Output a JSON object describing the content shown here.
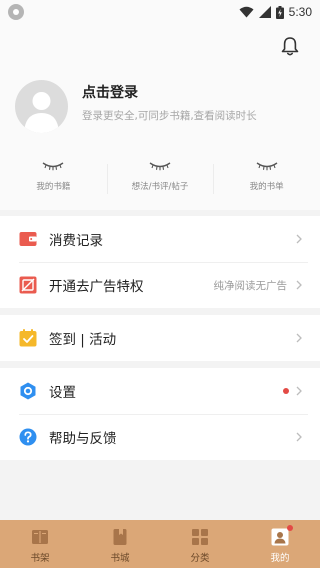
{
  "status_bar": {
    "time": "5:30"
  },
  "header": {
    "login_title": "点击登录",
    "login_subtitle": "登录更安全,可同步书籍,查看阅读时长"
  },
  "stats": [
    {
      "label": "我的书籍"
    },
    {
      "label": "想法/书评/帖子"
    },
    {
      "label": "我的书单"
    }
  ],
  "menu": {
    "consumption": {
      "label": "消费记录"
    },
    "ad_free": {
      "label": "开通去广告特权",
      "hint": "纯净阅读无广告"
    },
    "checkin": {
      "label": "签到 | 活动"
    },
    "settings": {
      "label": "设置",
      "has_dot": true
    },
    "help": {
      "label": "帮助与反馈"
    }
  },
  "tabs": [
    {
      "label": "书架",
      "icon": "bookshelf-icon"
    },
    {
      "label": "书城",
      "icon": "bookstore-icon"
    },
    {
      "label": "分类",
      "icon": "category-icon"
    },
    {
      "label": "我的",
      "icon": "profile-icon",
      "active": true,
      "badge": true
    }
  ],
  "colors": {
    "accent_red": "#e34a45",
    "tabbar_bg": "#dba777",
    "checkin_yellow": "#f5b82a",
    "settings_blue": "#2f8ff0"
  }
}
